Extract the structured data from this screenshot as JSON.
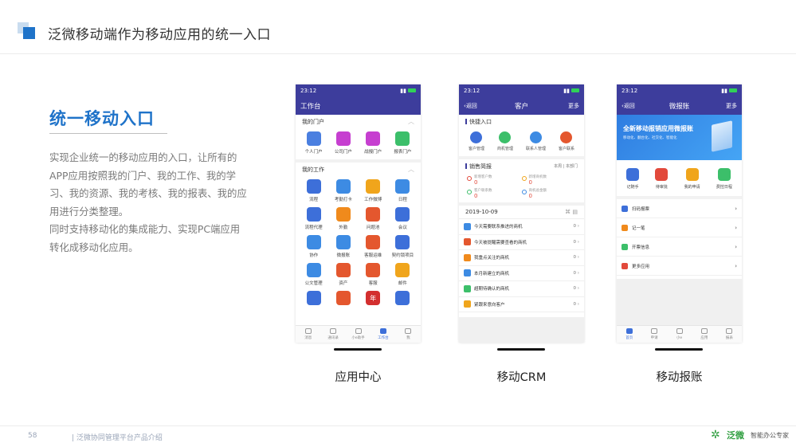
{
  "header": {
    "title": "泛微移动端作为移动应用的统一入口"
  },
  "section": {
    "title": "统一移动入口",
    "paragraphs": [
      "实现企业统一的移动应用的入口，让所有的APP应用按照我的门户、我的工作、我的学习、我的资源、我的考核、我的报表、我的应用进行分类整理。",
      "同时支持移动化的集成能力、实现PC端应用转化成移动化应用。"
    ]
  },
  "phones": {
    "app_center": {
      "caption": "应用中心",
      "time": "23:12",
      "title": "工作台",
      "portal_group": "我的门户",
      "portal_items": [
        {
          "label": "个人门户",
          "color": "#4a7fe0"
        },
        {
          "label": "公司门户",
          "color": "#c63fd0"
        },
        {
          "label": "战报门户",
          "color": "#c63fd0"
        },
        {
          "label": "报表门户",
          "color": "#3cbf6a"
        }
      ],
      "work_group": "我的工作",
      "work_items": [
        {
          "label": "流程",
          "color": "#3d6fd9"
        },
        {
          "label": "考勤打卡",
          "color": "#3d8be3"
        },
        {
          "label": "工作微博",
          "color": "#f0a51c"
        },
        {
          "label": "日程",
          "color": "#3d8be3"
        },
        {
          "label": "流程代理",
          "color": "#3d6fd9"
        },
        {
          "label": "外勤",
          "color": "#f08a1c"
        },
        {
          "label": "问题池",
          "color": "#e4572e"
        },
        {
          "label": "会议",
          "color": "#3d6fd9"
        },
        {
          "label": "协作",
          "color": "#3d8be3"
        },
        {
          "label": "微报账",
          "color": "#3d8be3"
        },
        {
          "label": "客服运维",
          "color": "#e4572e"
        },
        {
          "label": "契约锁项目",
          "color": "#3d6fd9"
        },
        {
          "label": "公文管理",
          "color": "#3d8be3"
        },
        {
          "label": "资产",
          "color": "#e4572e"
        },
        {
          "label": "客服",
          "color": "#e4572e"
        },
        {
          "label": "邮件",
          "color": "#f0a51c"
        },
        {
          "label": "",
          "color": "#3d6fd9"
        },
        {
          "label": "",
          "color": "#e4572e"
        },
        {
          "label": "年",
          "color": "#d32f2f"
        },
        {
          "label": "",
          "color": "#3d6fd9"
        }
      ],
      "tabs": [
        {
          "label": "消息",
          "active": false
        },
        {
          "label": "通讯录",
          "active": false
        },
        {
          "label": "小e助手",
          "active": false
        },
        {
          "label": "工作台",
          "active": true
        },
        {
          "label": "我",
          "active": false
        }
      ]
    },
    "crm": {
      "caption": "移动CRM",
      "time": "23:12",
      "back": "返回",
      "title": "客户",
      "more": "更多",
      "quick_title": "快捷入口",
      "quick_items": [
        {
          "label": "客户管理",
          "color": "#3d6fd9"
        },
        {
          "label": "商机管理",
          "color": "#3cbf6a"
        },
        {
          "label": "联系人管理",
          "color": "#3d8be3"
        },
        {
          "label": "客户联系",
          "color": "#e4572e"
        }
      ],
      "brief_title": "销售简报",
      "brief_filter": "本周 | 本部门",
      "stats": [
        {
          "label": "新增客户数",
          "value": "0",
          "color": "#e2493b"
        },
        {
          "label": "新增商机数",
          "value": "0",
          "color": "#f0a51c"
        },
        {
          "label": "客户联系数",
          "value": "0",
          "color": "#3cbf6a"
        },
        {
          "label": "商机总金额",
          "value": "0",
          "color": "#3d8be3"
        }
      ],
      "date": "2019-10-09",
      "rows": [
        {
          "label": "今天需要联系推进的商机",
          "count": "0",
          "color": "#3d8be3"
        },
        {
          "label": "今天被提醒需要查看的商机",
          "count": "0",
          "color": "#e4572e"
        },
        {
          "label": "我重点关注的商机",
          "count": "0",
          "color": "#f08a1c"
        },
        {
          "label": "本月新建立的商机",
          "count": "0",
          "color": "#3d8be3"
        },
        {
          "label": "超期待确认的商机",
          "count": "0",
          "color": "#3cbf6a"
        },
        {
          "label": "紧跟来意向客户",
          "count": "0",
          "color": "#f0a51c"
        }
      ]
    },
    "expense": {
      "caption": "移动报账",
      "time": "23:12",
      "back": "返回",
      "title": "微报账",
      "more": "更多",
      "banner_title": "全新移动报销应用微报账",
      "banner_sub": "移动化、翻台化、社交化、智能化",
      "icons": [
        {
          "label": "记随手",
          "color": "#3d6fd9"
        },
        {
          "label": "待审批",
          "color": "#e2493b"
        },
        {
          "label": "我的申请",
          "color": "#f0a51c"
        },
        {
          "label": "费控日程",
          "color": "#3cbf6a"
        }
      ],
      "rows": [
        {
          "label": "扫码报票",
          "color": "#3d6fd9"
        },
        {
          "label": "记一笔",
          "color": "#f08a1c"
        },
        {
          "label": "开票信息",
          "color": "#3cbf6a"
        },
        {
          "label": "更多应用",
          "color": "#e2493b"
        }
      ],
      "tabs": [
        {
          "label": "首页",
          "active": true
        },
        {
          "label": "申请",
          "active": false
        },
        {
          "label": "小e",
          "active": false
        },
        {
          "label": "应用",
          "active": false
        },
        {
          "label": "报表",
          "active": false
        }
      ]
    }
  },
  "footer": {
    "page": "58",
    "text": "| 泛微协同管理平台产品介绍",
    "logo_name": "泛微",
    "logo_slogan": "智能办公专家"
  }
}
